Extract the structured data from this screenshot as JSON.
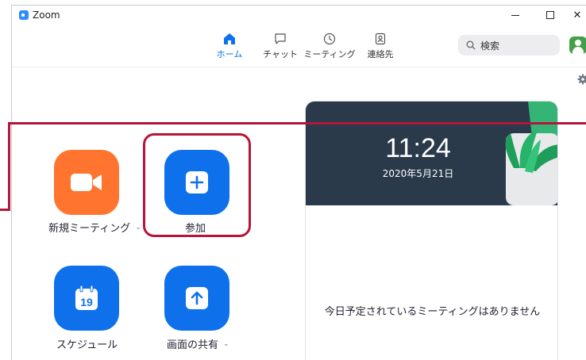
{
  "window": {
    "title": "Zoom"
  },
  "nav": {
    "tabs": [
      {
        "label": "ホーム",
        "icon": "home-icon",
        "active": true
      },
      {
        "label": "チャット",
        "icon": "chat-icon",
        "active": false
      },
      {
        "label": "ミーティング",
        "icon": "clock-icon",
        "active": false
      },
      {
        "label": "連絡先",
        "icon": "contacts-icon",
        "active": false
      }
    ]
  },
  "search": {
    "placeholder": "検索"
  },
  "actions": {
    "new_meeting": {
      "label": "新規ミーティング",
      "icon": "video-camera-icon",
      "color": "#ff742e"
    },
    "join": {
      "label": "参加",
      "icon": "plus-icon",
      "color": "#0e71eb"
    },
    "schedule": {
      "label": "スケジュール",
      "icon": "calendar-icon",
      "day": "19",
      "color": "#0e71eb"
    },
    "share": {
      "label": "画面の共有",
      "icon": "share-screen-icon",
      "color": "#0e71eb"
    }
  },
  "clock": {
    "time": "11:24",
    "date": "2020年5月21日"
  },
  "meetings": {
    "empty_text": "今日予定されているミーティングはありません"
  },
  "colors": {
    "accent": "#0e71eb",
    "orange": "#ff742e",
    "highlight": "#b5153a",
    "card_header": "#2a3a4b"
  }
}
